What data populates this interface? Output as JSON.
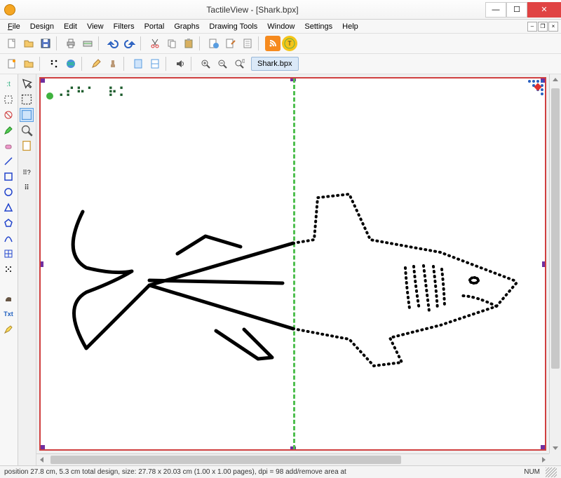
{
  "app": {
    "title": "TactileView - [Shark.bpx]"
  },
  "menus": [
    "File",
    "Design",
    "Edit",
    "View",
    "Filters",
    "Portal",
    "Graphs",
    "Drawing Tools",
    "Window",
    "Settings",
    "Help"
  ],
  "toolbar1": {
    "new": "new-file",
    "open": "open-file",
    "save": "save-file",
    "print": "print",
    "scan": "scan",
    "undo": "undo",
    "redo": "redo",
    "cut": "cut",
    "copy": "copy",
    "paste": "paste",
    "world": "world",
    "brush": "brush",
    "doc": "doc",
    "rss": "rss",
    "tv": "tactileview-logo"
  },
  "toolbar2": {
    "a": "toggle-a",
    "open2": "open",
    "braille": "braille-pattern",
    "globe": "globe",
    "pencil": "pencil",
    "stamp": "stamp",
    "page1": "page",
    "page2": "page-alt",
    "speaker": "audio",
    "zoomin": "zoom-in",
    "zoomout": "zoom-out",
    "zoomfit": "zoom-fit",
    "tab_label": "Shark.bpx"
  },
  "lefttools": {
    "text_tool": ":t",
    "select_rect": "select",
    "retouch": "retouch",
    "pencil_g": "pencil-green",
    "eraser": "eraser",
    "line": "line",
    "square": "square",
    "circle": "circle",
    "triangle": "triangle",
    "polygon": "polygon",
    "curve": "curve",
    "table": "table",
    "dots": "dots",
    "mammoth": "mammoth",
    "txt_label": "Txt",
    "highlight": "highlight"
  },
  "secondtools": {
    "pointer": "pointer",
    "selbox": "selection-box",
    "marquee": "marquee",
    "zoom": "zoom",
    "page": "page",
    "bfill": "braille-fill",
    "bdots": "braille-dots"
  },
  "canvas": {
    "braille_text": ":Sha rk"
  },
  "statusbar": {
    "text": "position 27.8 cm, 5.3 cm total design, size: 27.78 x 20.03 cm (1.00 x 1.00 pages), dpi = 98 add/remove area at",
    "num": "NUM"
  }
}
